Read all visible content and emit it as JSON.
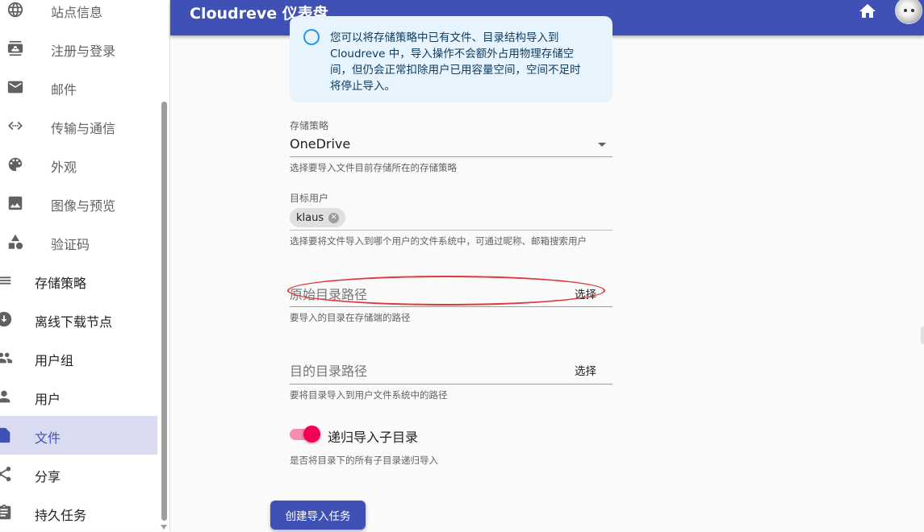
{
  "sidebar": {
    "sub_items": [
      {
        "label": "站点信息",
        "icon": "globe-icon"
      },
      {
        "label": "注册与登录",
        "icon": "contact-card-icon"
      },
      {
        "label": "邮件",
        "icon": "mail-icon"
      },
      {
        "label": "传输与通信",
        "icon": "code-arrows-icon"
      },
      {
        "label": "外观",
        "icon": "palette-icon"
      },
      {
        "label": "图像与预览",
        "icon": "image-icon"
      },
      {
        "label": "验证码",
        "icon": "shapes-icon"
      }
    ],
    "top_items": [
      {
        "label": "存储策略",
        "icon": "list-icon"
      },
      {
        "label": "离线下载节点",
        "icon": "download-node-icon"
      },
      {
        "label": "用户组",
        "icon": "group-icon"
      },
      {
        "label": "用户",
        "icon": "user-icon"
      },
      {
        "label": "文件",
        "icon": "file-icon",
        "active": true
      },
      {
        "label": "分享",
        "icon": "share-icon"
      },
      {
        "label": "持久任务",
        "icon": "task-icon"
      }
    ]
  },
  "appbar": {
    "title": "Cloudreve 仪表盘",
    "home_icon": "home-icon",
    "avatar": "user-avatar"
  },
  "info": {
    "lines": [
      "您可以将存储策略中已有文件、目录结构导入到",
      "Cloudreve 中，导入操作不会额外占用物理存储空",
      "间，但仍会正常扣除用户已用容量空间，空间不足时",
      "将停止导入。"
    ]
  },
  "form": {
    "policy": {
      "label": "存储策略",
      "value": "OneDrive",
      "help": "选择要导入文件目前存储所在的存储策略"
    },
    "target_user": {
      "label": "目标用户",
      "chip": "klaus",
      "help": "选择要将文件导入到哪个用户的文件系统中，可通过昵称、邮箱搜索用户"
    },
    "src_path": {
      "placeholder": "原始目录路径",
      "button": "选择",
      "help": "要导入的目录在存储端的路径"
    },
    "dst_path": {
      "placeholder": "目的目录路径",
      "button": "选择",
      "help": "要将目录导入到用户文件系统中的路径"
    },
    "recursive": {
      "label": "递归导入子目录",
      "checked": true,
      "help": "是否将目录下的所有子目录递归导入"
    },
    "submit": "创建导入任务"
  },
  "colors": {
    "primary": "#3f51b5",
    "accent": "#f50057",
    "annotation": "#e0383a"
  }
}
